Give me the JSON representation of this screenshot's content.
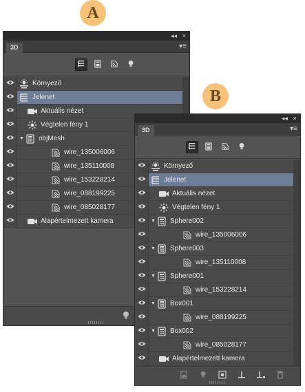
{
  "badges": {
    "a": "A",
    "b": "B"
  },
  "titlebar": {
    "collapse": "◂◂",
    "close": "×"
  },
  "tab": {
    "label": "3D"
  },
  "menu_glyph": "▾≡",
  "filters": [
    "scene-filter-icon",
    "mesh-filter-icon",
    "material-filter-icon",
    "light-filter-icon"
  ],
  "panel_a": {
    "rows": [
      {
        "label": "Környező",
        "icon": "environment-icon",
        "indent": 0,
        "expand": ""
      },
      {
        "label": "Jelenet",
        "icon": "scene-icon",
        "indent": 0,
        "expand": "",
        "selected": true
      },
      {
        "label": "Aktuális nézet",
        "icon": "camera-icon",
        "indent": 1,
        "expand": ""
      },
      {
        "label": "Végtelen fény 1",
        "icon": "light-icon",
        "indent": 1,
        "expand": ""
      },
      {
        "label": "objMesh",
        "icon": "mesh-icon",
        "indent": 0,
        "expand": "▼"
      },
      {
        "label": "wire_135006006",
        "icon": "material-icon",
        "indent": 2,
        "expand": ""
      },
      {
        "label": "wire_135110008",
        "icon": "material-icon",
        "indent": 2,
        "expand": ""
      },
      {
        "label": "wire_153228214",
        "icon": "material-icon",
        "indent": 2,
        "expand": ""
      },
      {
        "label": "wire_088199225",
        "icon": "material-icon",
        "indent": 2,
        "expand": ""
      },
      {
        "label": "wire_085028177",
        "icon": "material-icon",
        "indent": 2,
        "expand": ""
      },
      {
        "label": "Alapértelmezett kamera",
        "icon": "camera-icon",
        "indent": 1,
        "expand": ""
      }
    ]
  },
  "panel_b": {
    "rows": [
      {
        "label": "Környező",
        "icon": "environment-icon",
        "indent": 0,
        "expand": ""
      },
      {
        "label": "Jelenet",
        "icon": "scene-icon",
        "indent": 0,
        "expand": "",
        "selected": true
      },
      {
        "label": "Aktuális nézet",
        "icon": "camera-icon",
        "indent": 1,
        "expand": ""
      },
      {
        "label": "Végtelen fény 1",
        "icon": "light-icon",
        "indent": 1,
        "expand": ""
      },
      {
        "label": "Sphere002",
        "icon": "mesh-icon",
        "indent": 0,
        "expand": "▼"
      },
      {
        "label": "wire_135006006",
        "icon": "material-icon",
        "indent": 2,
        "expand": ""
      },
      {
        "label": "Sphere003",
        "icon": "mesh-icon",
        "indent": 0,
        "expand": "▼"
      },
      {
        "label": "wire_135110008",
        "icon": "material-icon",
        "indent": 2,
        "expand": ""
      },
      {
        "label": "Sphere001",
        "icon": "mesh-icon",
        "indent": 0,
        "expand": "▼"
      },
      {
        "label": "wire_153228214",
        "icon": "material-icon",
        "indent": 2,
        "expand": ""
      },
      {
        "label": "Box001",
        "icon": "mesh-icon",
        "indent": 0,
        "expand": "▼"
      },
      {
        "label": "wire_088199225",
        "icon": "material-icon",
        "indent": 2,
        "expand": ""
      },
      {
        "label": "Box002",
        "icon": "mesh-icon",
        "indent": 0,
        "expand": "▼"
      },
      {
        "label": "wire_085028177",
        "icon": "material-icon",
        "indent": 2,
        "expand": ""
      },
      {
        "label": "Alapértelmezett kamera",
        "icon": "camera-icon",
        "indent": 1,
        "expand": ""
      }
    ]
  },
  "footer_b_icons": [
    "new-mesh-icon",
    "new-light-icon",
    "constraint-icon",
    "ground-icon",
    "ground-options-icon",
    "delete-icon"
  ],
  "colors": {
    "selected_row": "#6d7d96",
    "panel_bg": "#535353",
    "badge": "#f6c27a"
  }
}
